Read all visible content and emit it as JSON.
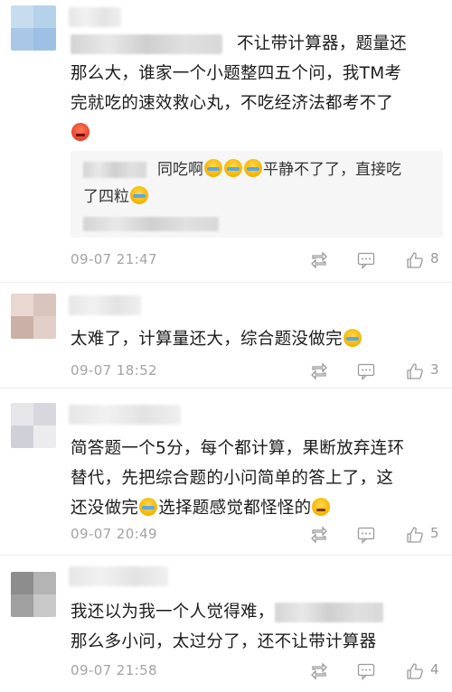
{
  "comments": [
    {
      "text_pre_blur": "",
      "text": "不让带计算器，题量还那么大，谁家一个小题整四五个问，我TM考完就吃的速效救心丸，不吃经济法都考不了",
      "line1": "不让带计算器，题量还",
      "line2": "那么大，谁家一个小题整四五个问，我TM考",
      "line3": "完就吃的速效救心丸，不吃经济法都考不了",
      "reply": {
        "line1_a": "同吃啊",
        "line1_b": "平静不了了，直接吃",
        "line2": "了四粒"
      },
      "time": "09-07 21:47",
      "likes": "8"
    },
    {
      "line1": "太难了，计算量还大，综合题没做完",
      "time": "09-07 18:52",
      "likes": "3"
    },
    {
      "line1": "简答题一个5分，每个都计算，果断放弃连环",
      "line2": "替代，先把综合题的小问简单的答上了，这",
      "line3a": "还没做完",
      "line3b": "选择题感觉都怪怪的",
      "time": "09-07 20:49",
      "likes": "5"
    },
    {
      "line1": "我还以为我一个人觉得难，",
      "line2": "那么多小问，太过分了，还不让带计算器",
      "time": "09-07 21:58",
      "likes": "4"
    }
  ],
  "icons": {
    "repost": "repost-icon",
    "comment": "comment-icon",
    "like": "thumbs-up-icon"
  },
  "colors": {
    "meta_text": "#a3a3a3",
    "reply_bg": "#f6f6f6",
    "body_text": "#1b1b1b"
  }
}
